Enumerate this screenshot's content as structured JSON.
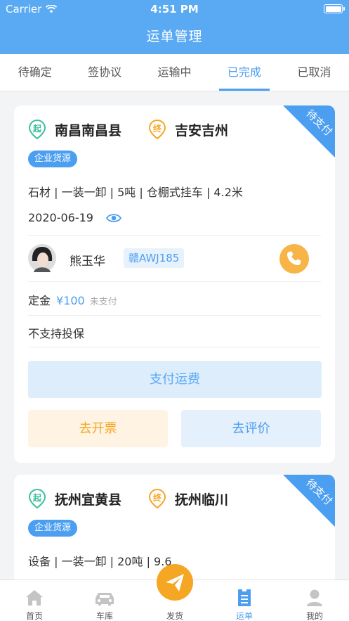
{
  "status_bar": {
    "carrier": "Carrier",
    "time": "4:51 PM"
  },
  "nav": {
    "title": "运单管理"
  },
  "tabs": [
    "待确定",
    "签协议",
    "运输中",
    "已完成",
    "已取消"
  ],
  "active_tab": "已完成",
  "orders": [
    {
      "ribbon": "待支付",
      "start_badge": "起",
      "end_badge": "终",
      "origin": "南昌南昌县",
      "destination": "吉安吉州",
      "source_tag": "企业货源",
      "cargo": "石材 | 一装一卸 | 5吨 | 仓棚式挂车 | 4.2米",
      "date": "2020-06-19",
      "driver_name": "熊玉华",
      "plate": "赣AWJ185",
      "deposit_label": "定金",
      "deposit_amount": "¥100",
      "deposit_status": "未支付",
      "insurance": "不支持投保",
      "pay_button": "支付运费",
      "invoice_button": "去开票",
      "review_button": "去评价"
    },
    {
      "ribbon": "待支付",
      "start_badge": "起",
      "end_badge": "终",
      "origin": "抚州宜黄县",
      "destination": "抚州临川",
      "source_tag": "企业货源",
      "cargo": "设备 | 一装一卸 | 20吨 | 9.6"
    }
  ],
  "tabbar": [
    {
      "label": "首页",
      "icon": "home-icon"
    },
    {
      "label": "车库",
      "icon": "car-icon"
    },
    {
      "label": "发货",
      "icon": "paper-plane-icon"
    },
    {
      "label": "运单",
      "icon": "waybill-icon"
    },
    {
      "label": "我的",
      "icon": "user-icon"
    }
  ],
  "colors": {
    "primary": "#5aaaf3",
    "accent_blue": "#4b9ef0",
    "orange": "#f5a623",
    "green": "#3bbf9a"
  }
}
